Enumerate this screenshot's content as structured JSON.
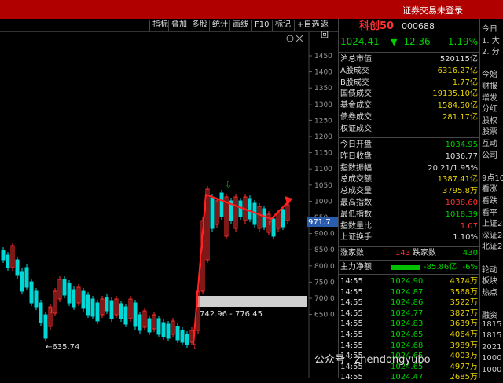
{
  "topbar": {
    "login_status": "证券交易未登录"
  },
  "toolbar": [
    "指标",
    "叠加",
    "多股",
    "统计",
    "画线",
    "F10",
    "标记",
    "+自选",
    "返回"
  ],
  "chart": {
    "price_ticks": [
      "1450",
      "1400",
      "1350",
      "1300",
      "1250",
      "1200",
      "1150",
      "1100",
      "1050",
      "1000",
      "950",
      "900.0",
      "850.0",
      "800.0",
      "750.0",
      "700.0",
      "650.0"
    ],
    "current_price_tag": "971.7",
    "low_label": "←635.74",
    "gap_label": "742.96 - 776.45",
    "window_controls": [
      "settings-icon",
      "close-icon"
    ],
    "colors": {
      "up": "#ff3030",
      "down": "#00d8d8",
      "annotation": "#ff2020",
      "marker": "#00c000"
    }
  },
  "quote": {
    "name": "科创50",
    "code": "000688",
    "price": "1024.41",
    "arrow": "▼",
    "change": "-12.36",
    "change_pct": "-1.19%",
    "stats": [
      {
        "label": "沪总市值",
        "value": "520115亿",
        "cls": "w"
      },
      {
        "label": "A股成交",
        "value": "6316.27亿",
        "cls": "y"
      },
      {
        "label": "B股成交",
        "value": "1.77亿",
        "cls": "y"
      },
      {
        "label": "国债成交",
        "value": "19135.10亿",
        "cls": "y"
      },
      {
        "label": "基金成交",
        "value": "1584.50亿",
        "cls": "y"
      },
      {
        "label": "债券成交",
        "value": "281.17亿",
        "cls": "y"
      },
      {
        "label": "权证成交",
        "value": "",
        "cls": "y"
      }
    ],
    "stats2": [
      {
        "label": "今日开盘",
        "value": "1034.95",
        "cls": "g"
      },
      {
        "label": "昨日收盘",
        "value": "1036.77",
        "cls": "w"
      },
      {
        "label": "指数振幅",
        "value": "20.21/1.95%",
        "cls": "w"
      },
      {
        "label": "总成交额",
        "value": "1387.41亿",
        "cls": "y"
      },
      {
        "label": "总成交量",
        "value": "3795.8万",
        "cls": "y"
      },
      {
        "label": "最高指数",
        "value": "1038.60",
        "cls": "rd"
      },
      {
        "label": "最低指数",
        "value": "1018.39",
        "cls": "g"
      },
      {
        "label": "指数量比",
        "value": "1.07",
        "cls": "rd"
      },
      {
        "label": "上证换手",
        "value": "1.10%",
        "cls": "w"
      }
    ],
    "breadth": {
      "up_label": "涨家数",
      "up": "143",
      "down_label": "跌家数",
      "down": "430"
    },
    "netflow": {
      "label": "主力净额",
      "value": "-85.86亿",
      "pct": "-6%"
    },
    "ticks": [
      {
        "time": "14:55",
        "price": "1024.90",
        "vol": "4374万"
      },
      {
        "time": "14:55",
        "price": "1024.87",
        "vol": "3568万"
      },
      {
        "time": "14:55",
        "price": "1024.86",
        "vol": "3522万"
      },
      {
        "time": "14:55",
        "price": "1024.77",
        "vol": "3827万"
      },
      {
        "time": "14:55",
        "price": "1024.83",
        "vol": "3639万"
      },
      {
        "time": "14:55",
        "price": "1024.65",
        "vol": "4064万"
      },
      {
        "time": "14:55",
        "price": "1024.68",
        "vol": "3989万"
      },
      {
        "time": "14:55",
        "price": "1024.65",
        "vol": "4003万"
      },
      {
        "time": "14:55",
        "price": "1024.65",
        "vol": "4977万"
      },
      {
        "time": "14:55",
        "price": "1024.47",
        "vol": "2685万"
      }
    ]
  },
  "far_panel": [
    "今日",
    "1. 大",
    "2. 分",
    "",
    "今始",
    "财报",
    "增发",
    "分红",
    "股权",
    "股票",
    "互动",
    "公司",
    "",
    "9点10",
    "看涨",
    "看跌",
    "看平",
    "上证2",
    "深证2",
    "北证2",
    "",
    "轮动",
    "板块",
    "热点",
    "",
    "融资",
    "1815",
    "1815",
    "2021",
    "1000",
    "1000"
  ],
  "watermark": "公众号 · zhendongyubo"
}
